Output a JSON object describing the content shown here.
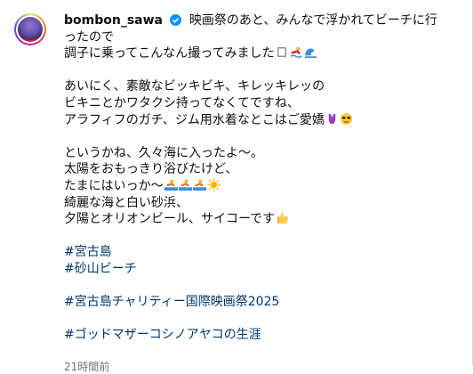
{
  "post": {
    "username": "bombon_sawa",
    "caption_first": "映画祭のあと、みんなで浮かれてビーチに行",
    "lines": {
      "l2": "ったので",
      "l3": "調子に乗ってこんなん撮ってみました",
      "l5": "あいにく、素敵なビッキビキ、キレッキレッの",
      "l6": "ビキニとかワタクシ持ってなくてですね、",
      "l7": "アラフィフのガチ、ジム用水着なとこはご愛嬌",
      "l9": "というかね、久々海に入ったよ〜。",
      "l10": "太陽をおもっきり浴びたけど、",
      "l11": "たまにはいっか〜",
      "l12": "綺麗な海と白い砂浜、",
      "l13": "夕陽とオリオンビール、サイコーです"
    },
    "hashtags": {
      "h1": "#宮古島",
      "h2": "#砂山ビーチ",
      "h3": "#宮古島チャリティー国際映画祭2025",
      "h4": "#ゴッドマザーコシノアヤコの生涯"
    },
    "timestamp": "21時間前"
  },
  "icons": {
    "verified": "verified-badge-icon",
    "emojis": [
      "box-icon",
      "swimmer-icon",
      "wave-icon",
      "swimsuit-icon",
      "sunglasses-face-icon",
      "person-swimming-icon",
      "sun-icon",
      "thumbs-up-icon"
    ]
  },
  "colors": {
    "hashtag": "#00376b",
    "verified": "#0095f6",
    "text": "#0f0f0f"
  }
}
